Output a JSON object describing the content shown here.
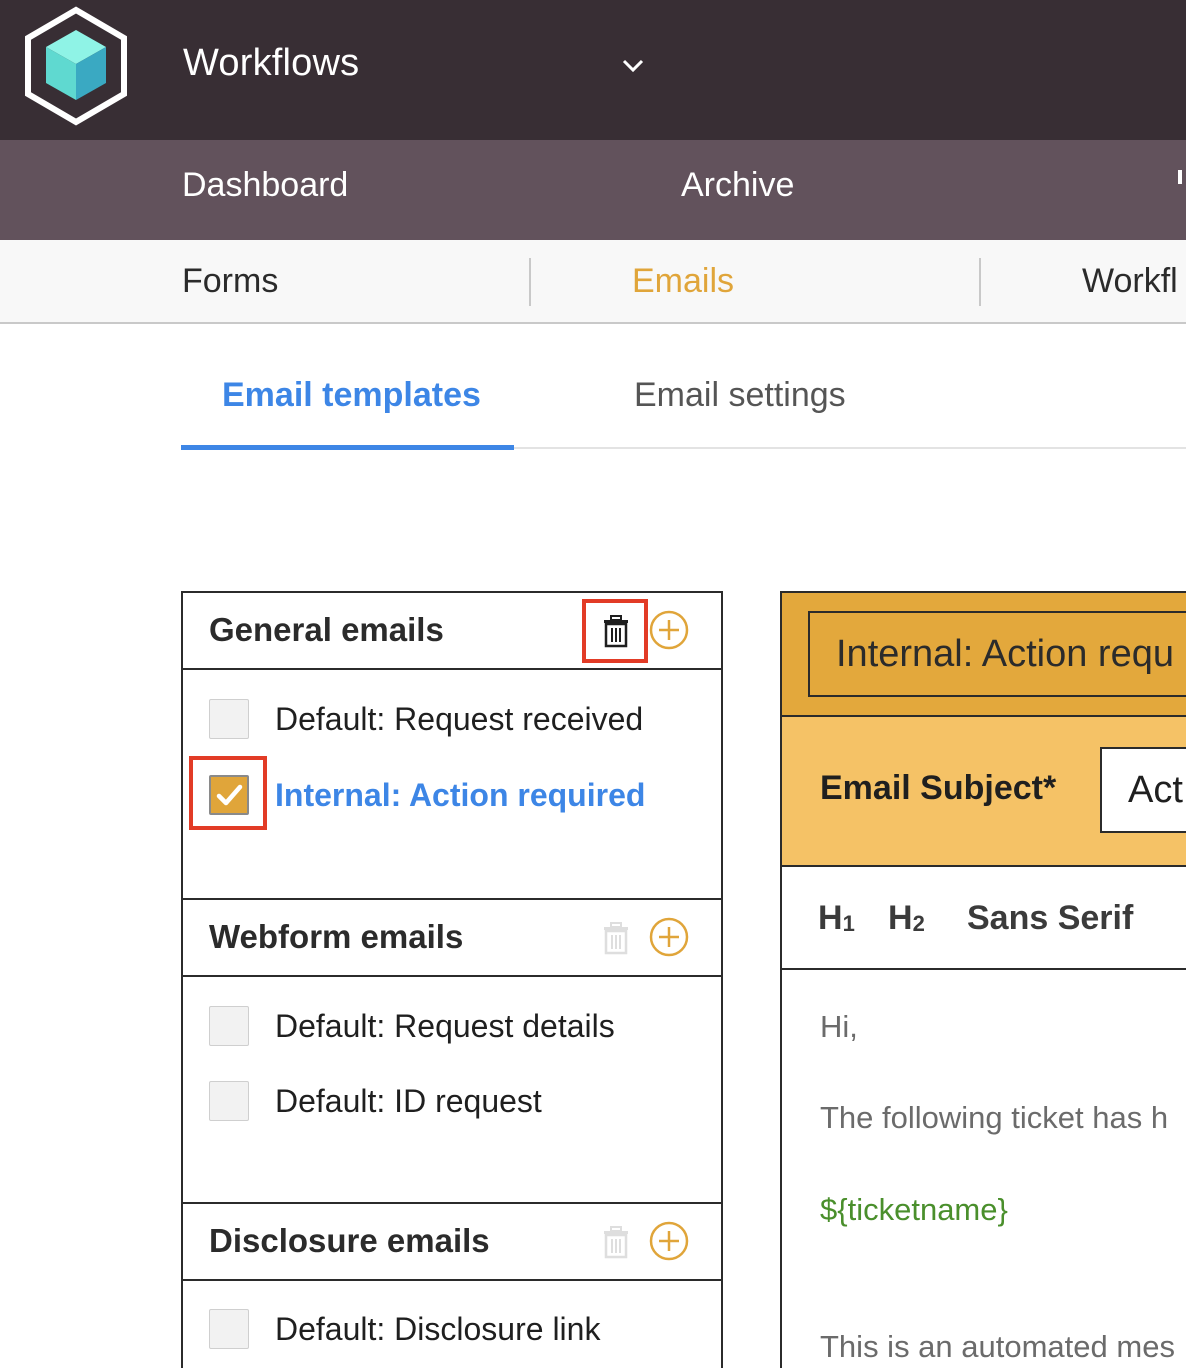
{
  "app": {
    "title": "Workflows",
    "logo_icon": "cube-hexagon-logo",
    "dropdown_icon": "chevron-down-icon"
  },
  "main_nav": {
    "items": [
      "Dashboard",
      "Archive"
    ]
  },
  "sub_nav": {
    "items": [
      "Forms",
      "Emails",
      "Workfl"
    ],
    "active": "Emails"
  },
  "tabs": {
    "items": [
      "Email templates",
      "Email settings"
    ],
    "active": "Email templates"
  },
  "sections": [
    {
      "title": "General emails",
      "items": [
        {
          "label": "Default: Request received",
          "checked": false
        },
        {
          "label": "Internal: Action required",
          "checked": true,
          "active": true
        }
      ]
    },
    {
      "title": "Webform emails",
      "items": [
        {
          "label": "Default: Request details",
          "checked": false
        },
        {
          "label": "Default: ID request",
          "checked": false
        }
      ]
    },
    {
      "title": "Disclosure emails",
      "items": [
        {
          "label": "Default: Disclosure link",
          "checked": false
        }
      ]
    }
  ],
  "editor": {
    "template_name": "Internal: Action requ",
    "subject_label": "Email Subject*",
    "subject_value": "Act",
    "toolbar": {
      "h1": "H",
      "h1_sub": "1",
      "h2": "H",
      "h2_sub": "2",
      "font": "Sans Serif"
    },
    "body_lines": [
      "Hi,",
      "The following ticket has h",
      "${ticketname}",
      "This is an automated mes"
    ]
  },
  "colors": {
    "topbar": "#382e34",
    "main_nav": "#62525c",
    "accent": "#e0a53a",
    "link_blue": "#3d86e6",
    "highlight_red": "#e23b26",
    "variable_green": "#4a8f2c"
  }
}
